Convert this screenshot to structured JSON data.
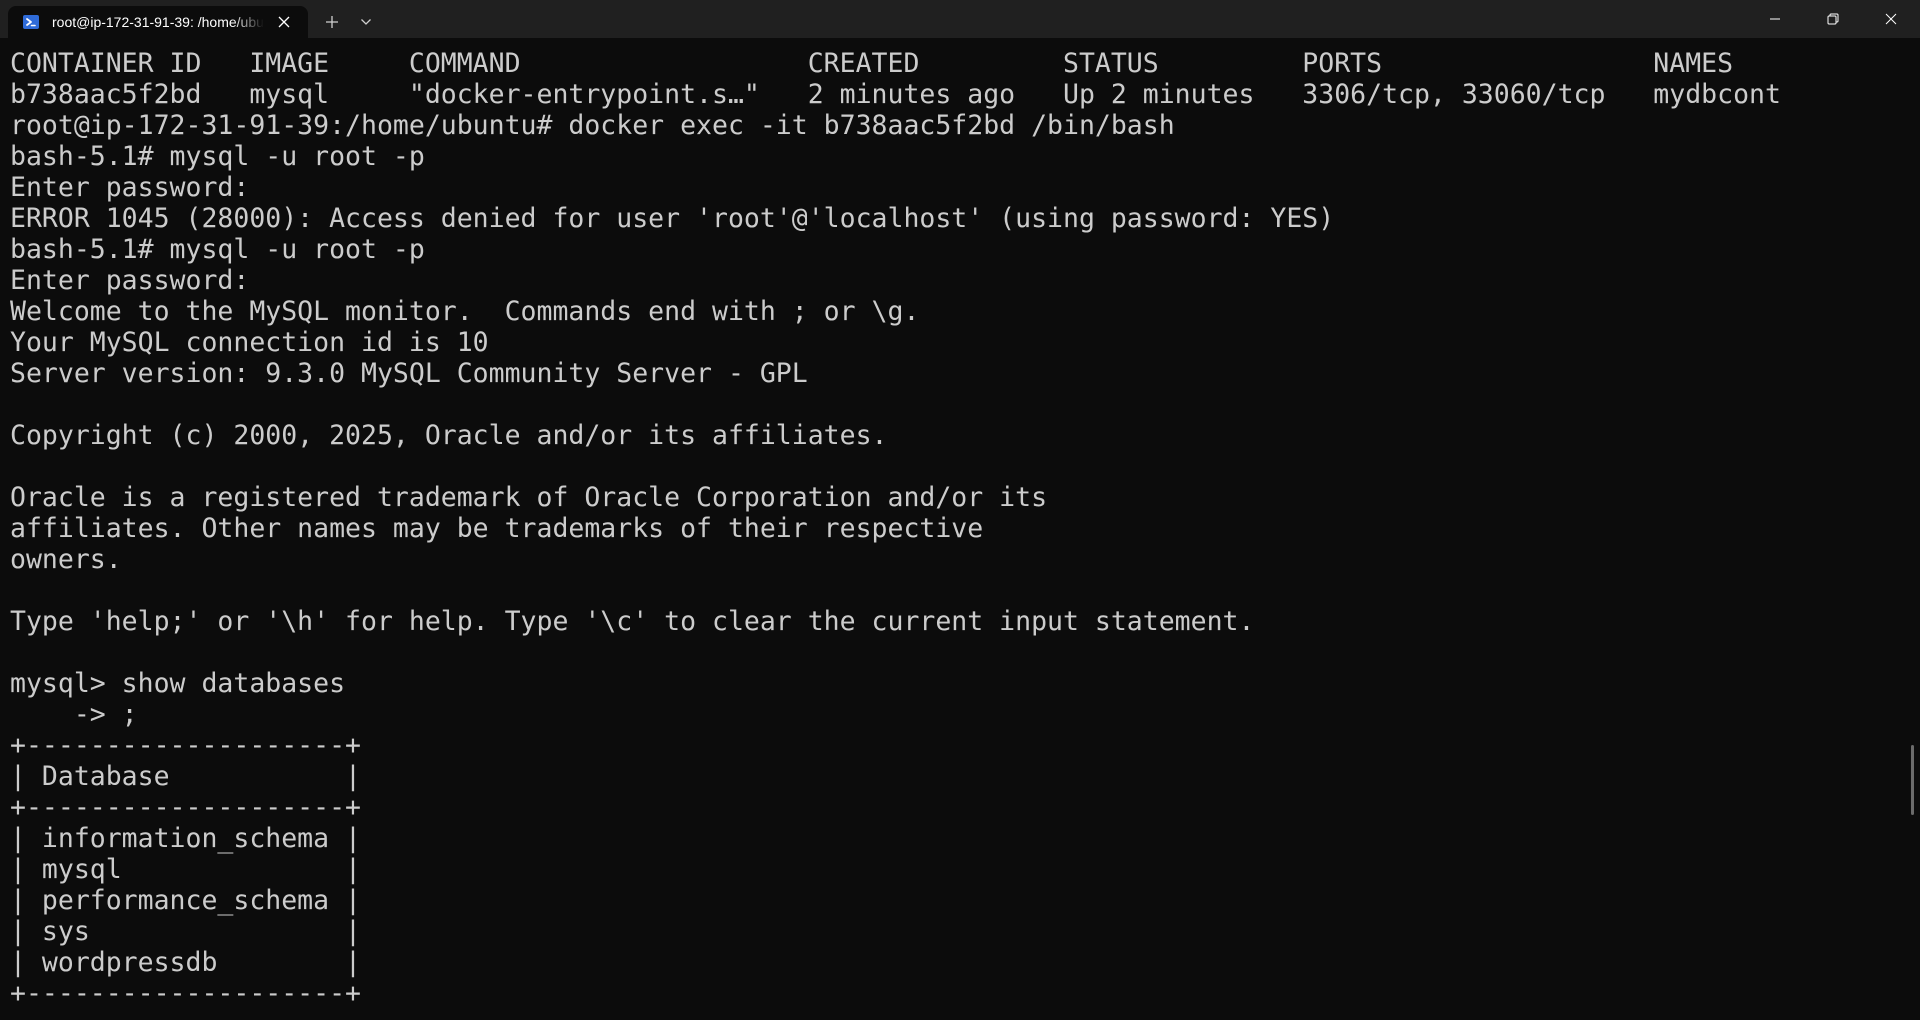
{
  "tab": {
    "title": "root@ip-172-31-91-39: /home/ubuntu",
    "icon": "powershell-icon"
  },
  "colors": {
    "titlebar_bg": "#202020",
    "terminal_bg": "#0c0c0c",
    "terminal_fg": "#cccccc",
    "tab_icon_accent": "#2f6bd8"
  },
  "terminal": {
    "lines": [
      "CONTAINER ID   IMAGE     COMMAND                  CREATED         STATUS         PORTS                 NAMES",
      "b738aac5f2bd   mysql     \"docker-entrypoint.s…\"   2 minutes ago   Up 2 minutes   3306/tcp, 33060/tcp   mydbcont",
      "root@ip-172-31-91-39:/home/ubuntu# docker exec -it b738aac5f2bd /bin/bash",
      "bash-5.1# mysql -u root -p",
      "Enter password:",
      "ERROR 1045 (28000): Access denied for user 'root'@'localhost' (using password: YES)",
      "bash-5.1# mysql -u root -p",
      "Enter password:",
      "Welcome to the MySQL monitor.  Commands end with ; or \\g.",
      "Your MySQL connection id is 10",
      "Server version: 9.3.0 MySQL Community Server - GPL",
      "",
      "Copyright (c) 2000, 2025, Oracle and/or its affiliates.",
      "",
      "Oracle is a registered trademark of Oracle Corporation and/or its",
      "affiliates. Other names may be trademarks of their respective",
      "owners.",
      "",
      "Type 'help;' or '\\h' for help. Type '\\c' to clear the current input statement.",
      "",
      "mysql> show databases",
      "    -> ;",
      "+--------------------+",
      "| Database           |",
      "+--------------------+",
      "| information_schema |",
      "| mysql              |",
      "| performance_schema |",
      "| sys                |",
      "| wordpressdb        |",
      "+--------------------+"
    ]
  }
}
